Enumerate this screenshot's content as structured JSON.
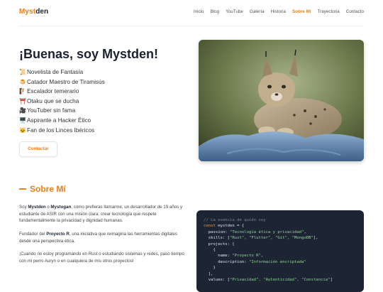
{
  "brand": {
    "part1": "Myst",
    "part2": "den"
  },
  "nav": [
    "Inicio",
    "Blog",
    "YouTube",
    "Galería",
    "Historia",
    "Sobre Mí",
    "Trayectoria",
    "Contacto"
  ],
  "nav_active": "Sobre Mí",
  "hero": {
    "title": "¡Buenas, soy Mystden!",
    "traits": [
      {
        "icon": "scroll-icon",
        "glyph": "📜",
        "text": "Novelista de Fantasía"
      },
      {
        "icon": "cake-icon",
        "glyph": "🍮",
        "text": "Catador Maestro de Tiramisús"
      },
      {
        "icon": "climber-icon",
        "glyph": "🧗",
        "text": "Escalador temerario"
      },
      {
        "icon": "torii-icon",
        "glyph": "⛩️",
        "text": "Otaku que se ducha"
      },
      {
        "icon": "camera-icon",
        "glyph": "🎥",
        "text": "YouTuber sin fama"
      },
      {
        "icon": "computer-icon",
        "glyph": "🖥️",
        "text": "Aspirante a Hacker Ético"
      },
      {
        "icon": "cat-icon",
        "glyph": "🐱",
        "text": "Fan de los Linces Ibéricos"
      }
    ],
    "contact_button": "Contactar"
  },
  "about": {
    "heading": "Sobre Mí",
    "p1": {
      "a": "Soy ",
      "b": "Mystden",
      "c": " o ",
      "d": "Mystogan",
      "e": ", como prefieras llamarme, un desarrollador de 19 años y estudiante de ASIR con una misión clara: crear tecnología que respete fundamentalmente la privacidad y dignidad humanas."
    },
    "p2": {
      "a": "Fundador del ",
      "b": "Proyecto R",
      "c": ", una iniciativa que reimagina las herramientas digitales desde una perspectiva ética."
    },
    "p3": "¡Cuando no estoy programando en Rust o estudiando sistemas y redes, paso tiempo con mi perro Auryn o en cualquiera de mis otros proyectos!"
  },
  "code": {
    "comment": "// La esencia de quién soy",
    "l1_kw": "const",
    "l1_rest": " mystden = {",
    "l2_key": "  passion: ",
    "l2_val": "\"Tecnología ética y privacidad\"",
    "l2_end": ",",
    "l3_key": "  skills: [",
    "l3_val": "\"Rust\", \"Flutter\", \"Git\", \"MongoDB\"",
    "l3_end": "],",
    "l4": "  projects: [",
    "l5": "    {",
    "l6_key": "      name: ",
    "l6_val": "\"Proyecto R\"",
    "l6_end": ",",
    "l7_key": "      description: ",
    "l7_val": "\"Información encriptada\"",
    "l8": "    }",
    "l9": "  ],",
    "l10_key": "  values: [",
    "l10_val": "\"Privacidad\", \"Autenticidad\", \"Constancia\"",
    "l10_end": "]"
  },
  "colors": {
    "accent": "#e8801a",
    "code_bg": "#1d2433"
  }
}
